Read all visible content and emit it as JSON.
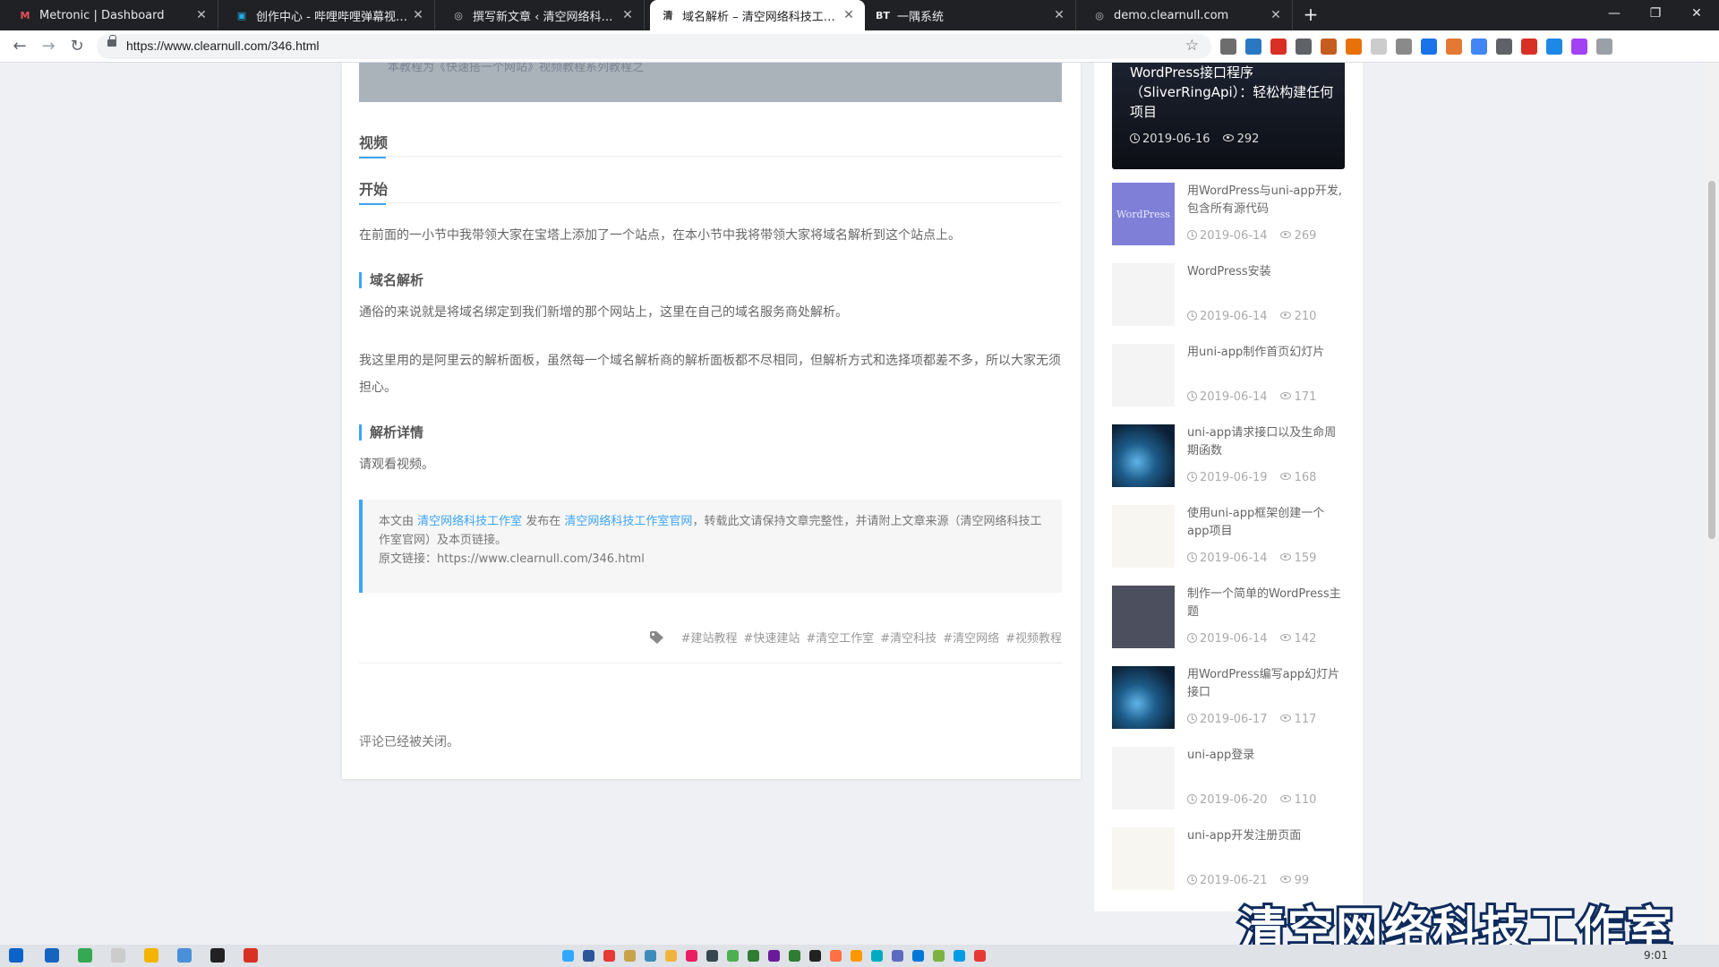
{
  "browser": {
    "tabs": [
      {
        "title": "Metronic | Dashboard",
        "favicon": "metronic-icon",
        "favicon_glyph": "M",
        "favicon_color": "#e8505b",
        "active": false
      },
      {
        "title": "创作中心 - 哔哩哔哩弹幕视频网",
        "favicon": "bilibili-icon",
        "favicon_glyph": "▣",
        "favicon_color": "#23ade5",
        "active": false
      },
      {
        "title": "撰写新文章 ‹ 清空网络科技工作室",
        "favicon": "wordpress-icon",
        "favicon_glyph": "◎",
        "favicon_color": "#bdc1c6",
        "active": false
      },
      {
        "title": "域名解析 – 清空网络科技工作室",
        "favicon": "site-icon",
        "favicon_glyph": "清",
        "favicon_color": "#333333",
        "active": true
      },
      {
        "title": "一隅系统",
        "favicon": "bt-icon",
        "favicon_glyph": "BT",
        "favicon_color": "#e8eaed",
        "active": false
      },
      {
        "title": "demo.clearnull.com",
        "favicon": "globe-icon",
        "favicon_glyph": "◎",
        "favicon_color": "#bdc1c6",
        "active": false
      }
    ],
    "new_tab": "+",
    "window_controls": {
      "minimize": "—",
      "maximize": "❐",
      "close": "✕"
    },
    "nav": {
      "back": "←",
      "forward": "→",
      "reload": "↻"
    },
    "url": "https://www.clearnull.com/346.html",
    "bookmark_star": "☆",
    "extension_colors": [
      "#6d6d6d",
      "#2b78c2",
      "#d93025",
      "#5f6368",
      "#c65d1e",
      "#e8710a",
      "#cccccc",
      "#8a8a8a",
      "#1a73e8",
      "#e37933",
      "#4285f4",
      "#5f6368",
      "#d93025",
      "#1e88e5",
      "#a142f4",
      "#9aa0a6"
    ]
  },
  "article": {
    "banner_text": "本教程为《快速搭一个网站》视频教程系列教程之",
    "section_video": "视频",
    "section_start": "开始",
    "intro": "在前面的一小节中我带领大家在宝塔上添加了一个站点，在本小节中我将带领大家将域名解析到这个站点上。",
    "heading_dns": "域名解析",
    "para_dns_1": "通俗的来说就是将域名绑定到我们新增的那个网站上，这里在自己的域名服务商处解析。",
    "para_dns_2": "我这里用的是阿里云的解析面板，虽然每一个域名解析商的解析面板都不尽相同，但解析方式和选择项都差不多，所以大家无须担心。",
    "heading_detail": "解析详情",
    "para_detail": "请观看视频。",
    "copyright": {
      "prefix": "本文由 ",
      "author": "清空网络科技工作室",
      "mid": " 发布在 ",
      "site": "清空网络科技工作室官网",
      "suffix": "，转载此文请保持文章完整性，并请附上文章来源（清空网络科技工作室官网）及本页链接。",
      "link_label": "原文链接：",
      "link_url": "https://www.clearnull.com/346.html"
    },
    "tags": [
      "#建站教程",
      "#快速建站",
      "#清空工作室",
      "#清空科技",
      "#清空网络",
      "#视频教程"
    ],
    "comments_closed": "评论已经被关闭。"
  },
  "sidebar": {
    "featured": {
      "title": "WordPress接口程序（SliverRingApi）：轻松构建任何项目",
      "date": "2019-06-16",
      "views": "292"
    },
    "posts": [
      {
        "title": "用WordPress与uni-app开发,包含所有源代码",
        "date": "2019-06-14",
        "views": "269",
        "thumb": "th-wp",
        "thumb_text": "WordPress"
      },
      {
        "title": "WordPress安装",
        "date": "2019-06-14",
        "views": "210",
        "thumb": "th-light",
        "thumb_text": ""
      },
      {
        "title": "用uni-app制作首页幻灯片",
        "date": "2019-06-14",
        "views": "171",
        "thumb": "th-light",
        "thumb_text": ""
      },
      {
        "title": "uni-app请求接口以及生命周期函数",
        "date": "2019-06-19",
        "views": "168",
        "thumb": "th-blue",
        "thumb_text": ""
      },
      {
        "title": "使用uni-app框架创建一个app项目",
        "date": "2019-06-14",
        "views": "159",
        "thumb": "th-code",
        "thumb_text": ""
      },
      {
        "title": "制作一个简单的WordPress主题",
        "date": "2019-06-14",
        "views": "142",
        "thumb": "th-dark",
        "thumb_text": ""
      },
      {
        "title": "用WordPress编写app幻灯片接口",
        "date": "2019-06-17",
        "views": "117",
        "thumb": "th-blue",
        "thumb_text": ""
      },
      {
        "title": "uni-app登录",
        "date": "2019-06-20",
        "views": "110",
        "thumb": "th-light",
        "thumb_text": ""
      },
      {
        "title": "uni-app开发注册页面",
        "date": "2019-06-21",
        "views": "99",
        "thumb": "th-code",
        "thumb_text": ""
      }
    ]
  },
  "watermark": "清空网络科技工作室",
  "taskbar": {
    "clock": "9:01",
    "app_colors": [
      "#1565c0",
      "#34a853",
      "#cccccc",
      "#f4b400",
      "#4a90d9",
      "#222222",
      "#d93025"
    ],
    "tray_colors": [
      "#31a8ff",
      "#2b579a",
      "#e53935",
      "#c9a24a",
      "#3c8dbc",
      "#f2b33d",
      "#e91e63",
      "#37474f",
      "#4caf50",
      "#2e7d32",
      "#6a1b9a",
      "#2e7d32",
      "#222222",
      "#ff7043",
      "#ff9800",
      "#00acc1",
      "#5c6bc0",
      "#0078d7",
      "#7cb342",
      "#039be5",
      "#e53935"
    ]
  }
}
